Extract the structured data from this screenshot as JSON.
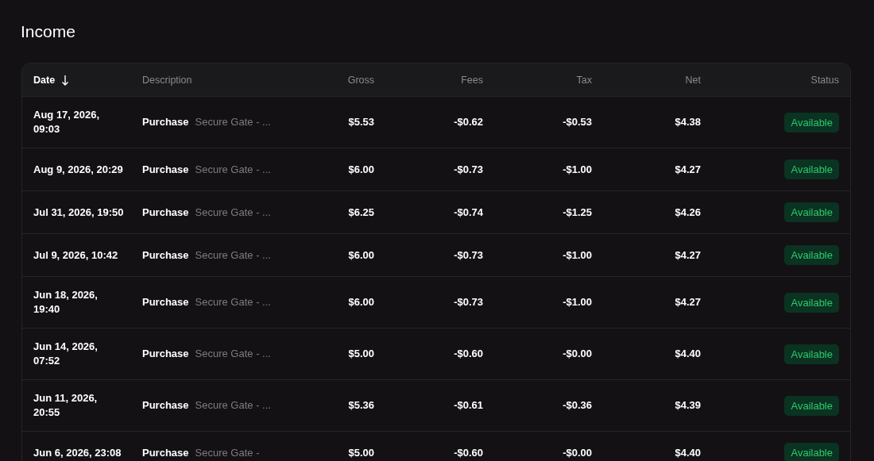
{
  "title": "Income",
  "table": {
    "columns": [
      {
        "label": "Date",
        "sorted": true
      },
      {
        "label": "Description",
        "sorted": false
      },
      {
        "label": "Gross",
        "sorted": false
      },
      {
        "label": "Fees",
        "sorted": false
      },
      {
        "label": "Tax",
        "sorted": false
      },
      {
        "label": "Net",
        "sorted": false
      },
      {
        "label": "Status",
        "sorted": false
      }
    ],
    "rows": [
      {
        "date": "Aug 17, 2026, 09:03",
        "type": "Purchase",
        "description": "Secure Gate - ...",
        "gross": "$5.53",
        "fees": "-$0.62",
        "tax": "-$0.53",
        "net": "$4.38",
        "status": "Available"
      },
      {
        "date": "Aug 9, 2026, 20:29",
        "type": "Purchase",
        "description": "Secure Gate - ...",
        "gross": "$6.00",
        "fees": "-$0.73",
        "tax": "-$1.00",
        "net": "$4.27",
        "status": "Available"
      },
      {
        "date": "Jul 31, 2026, 19:50",
        "type": "Purchase",
        "description": "Secure Gate - ...",
        "gross": "$6.25",
        "fees": "-$0.74",
        "tax": "-$1.25",
        "net": "$4.26",
        "status": "Available"
      },
      {
        "date": "Jul 9, 2026, 10:42",
        "type": "Purchase",
        "description": "Secure Gate - ...",
        "gross": "$6.00",
        "fees": "-$0.73",
        "tax": "-$1.00",
        "net": "$4.27",
        "status": "Available"
      },
      {
        "date": "Jun 18, 2026, 19:40",
        "type": "Purchase",
        "description": "Secure Gate - ...",
        "gross": "$6.00",
        "fees": "-$0.73",
        "tax": "-$1.00",
        "net": "$4.27",
        "status": "Available"
      },
      {
        "date": "Jun 14, 2026, 07:52",
        "type": "Purchase",
        "description": "Secure Gate - ...",
        "gross": "$5.00",
        "fees": "-$0.60",
        "tax": "-$0.00",
        "net": "$4.40",
        "status": "Available"
      },
      {
        "date": "Jun 11, 2026, 20:55",
        "type": "Purchase",
        "description": "Secure Gate - ...",
        "gross": "$5.36",
        "fees": "-$0.61",
        "tax": "-$0.36",
        "net": "$4.39",
        "status": "Available"
      },
      {
        "date": "Jun 6, 2026, 23:08",
        "type": "Purchase",
        "description": "Secure Gate -",
        "gross": "$5.00",
        "fees": "-$0.60",
        "tax": "-$0.00",
        "net": "$4.40",
        "status": "Available"
      }
    ]
  }
}
